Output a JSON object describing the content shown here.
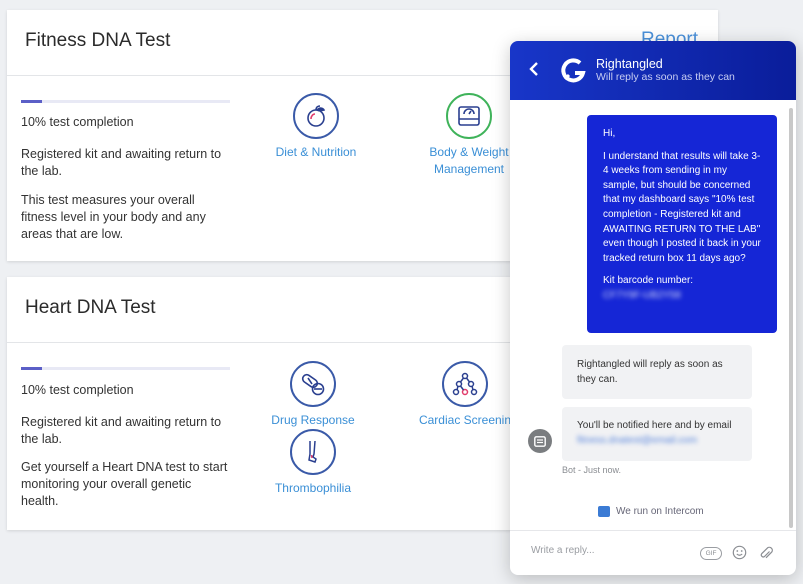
{
  "fitness": {
    "title": "Fitness DNA Test",
    "report": "Report",
    "progress": 0.1,
    "completion": "10% test completion",
    "status_line1": "Registered kit and awaiting return to",
    "status_line2": "the lab.",
    "desc_line1": "This test measures your overall",
    "desc_line2": "fitness level in your body and any",
    "desc_line3": "areas that are low.",
    "traits": [
      {
        "label": "Diet & Nutrition",
        "icon": "apple-icon"
      },
      {
        "label_line1": "Body & Weight",
        "label_line2": "Management",
        "icon": "scale-icon"
      }
    ]
  },
  "heart": {
    "title": "Heart DNA Test",
    "progress": 0.1,
    "completion": "10% test completion",
    "status_line1": "Registered kit and awaiting return to",
    "status_line2": "the lab.",
    "desc_line1": "Get yourself a Heart DNA test to start",
    "desc_line2": "monitoring your overall genetic",
    "desc_line3": "health.",
    "traits": [
      {
        "label": "Drug Response",
        "icon": "pills-icon"
      },
      {
        "label": "Cardiac Screenin",
        "icon": "molecule-icon"
      },
      {
        "label": "Thrombophilia",
        "icon": "leg-icon"
      }
    ]
  },
  "chat": {
    "name": "Rightangled",
    "subtitle": "Will reply as soon as they can",
    "user_message": {
      "greeting": "Hi,",
      "body": "I understand that results will take 3-4 weeks from sending in my sample, but should be concerned that my dashboard says \"10% test completion - Registered kit and AWAITING RETURN TO THE LAB\" even though I posted it back in your tracked return box 11 days ago?",
      "barcode_label": "Kit barcode number:",
      "barcode_value": "CF7Y9F-UB2Y58"
    },
    "bot_reply": "Rightangled will reply as soon as they can.",
    "bot_notify": "You'll be notified here and by email",
    "bot_email": "fitness.dnatest@email.com",
    "bot_meta": "Bot - Just now.",
    "powered_by": "We run on Intercom",
    "composer_placeholder": "Write a reply...",
    "gif_label": "GIF"
  },
  "colors": {
    "accent": "#1526d6",
    "progress": "#5b5fc7",
    "link": "#3a8fd6"
  }
}
